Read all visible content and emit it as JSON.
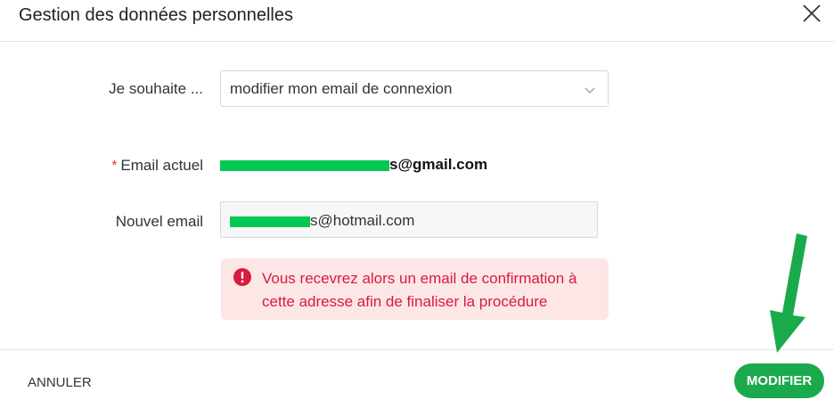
{
  "header": {
    "title": "Gestion des données personnelles",
    "close_icon": "close-icon"
  },
  "form": {
    "wish": {
      "label": "Je souhaite ...",
      "selected": "modifier mon email de connexion"
    },
    "current_email": {
      "required_mark": "*",
      "label": "Email actuel",
      "visible_suffix": "s@gmail.com"
    },
    "new_email": {
      "label": "Nouvel email",
      "visible_suffix": "s@hotmail.com"
    },
    "alert": {
      "icon": "exclamation-icon",
      "text": "Vous recevrez alors un email de confirmation à cette adresse afin de finaliser la procédure"
    }
  },
  "footer": {
    "cancel_label": "ANNULER",
    "submit_label": "MODIFIER"
  },
  "colors": {
    "primary": "#1aaa4b",
    "alert_bg": "#fde6e6",
    "alert_text": "#d81b3e",
    "redaction": "#00c853",
    "annotation_arrow": "#1aaa4b"
  }
}
